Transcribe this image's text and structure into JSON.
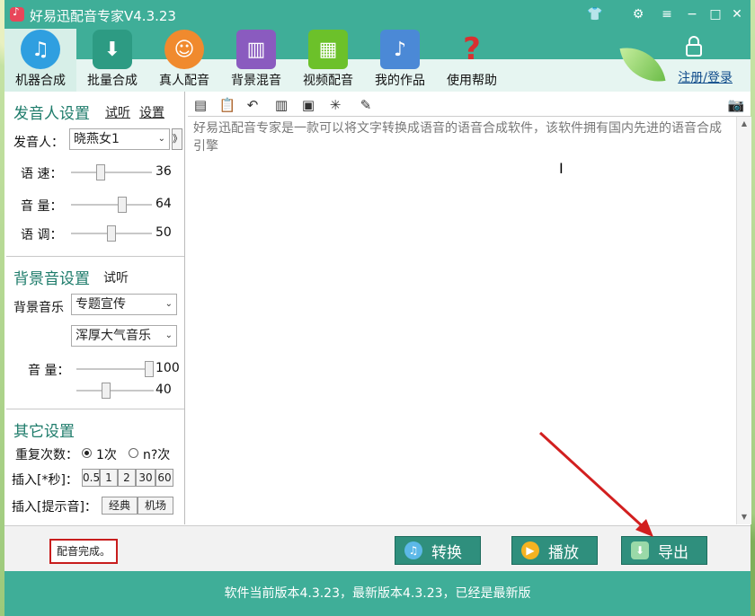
{
  "window": {
    "title": "好易迅配音专家V4.3.23"
  },
  "toolbar": {
    "tools": [
      {
        "label": "机器合成",
        "icon": "music-note-icon",
        "color": "#2f9fe0"
      },
      {
        "label": "批量合成",
        "icon": "mp3-file-icon",
        "color": "#2d9b83"
      },
      {
        "label": "真人配音",
        "icon": "person-icon",
        "color": "#f08a2e"
      },
      {
        "label": "背景混音",
        "icon": "equalizer-icon",
        "color": "#8a5bbf"
      },
      {
        "label": "视频配音",
        "icon": "film-icon",
        "color": "#6cc12a"
      },
      {
        "label": "我的作品",
        "icon": "music-folder-icon",
        "color": "#4b89d6"
      },
      {
        "label": "使用帮助",
        "icon": "question-icon",
        "color": "#d93030"
      }
    ],
    "login_label": "注册/登录"
  },
  "speaker": {
    "title": "发音人设置",
    "listen": "试听",
    "settings": "设置",
    "speaker_label": "发音人：",
    "speaker_value": "晓燕女1",
    "more": "》",
    "speed_label": "语 速：",
    "speed_value": "36",
    "volume_label": "音 量：",
    "volume_value": "64",
    "tone_label": "语 调：",
    "tone_value": "50"
  },
  "bgm": {
    "title": "背景音设置",
    "listen": "试听",
    "music_label": "背景音乐",
    "category": "专题宣传",
    "track": "浑厚大气音乐",
    "volume_label": "音 量：",
    "volume_value": "100",
    "volume2_value": "40"
  },
  "other": {
    "title": "其它设置",
    "repeat_label": "重复次数：",
    "repeat_opt1": "1次",
    "repeat_opt2": "n?次",
    "insert_label": "插入[*秒]：",
    "insert_opts": [
      "0.5",
      "1",
      "2",
      "30",
      "60"
    ],
    "insert_tone_label": "插入[提示音]：",
    "tone_opts": [
      "经典",
      "机场"
    ]
  },
  "editor": {
    "text": "好易迅配音专家是一款可以将文字转换成语音的语音合成软件，该软件拥有国内先进的语音合成引擎"
  },
  "bottom": {
    "status": "配音完成。",
    "convert": "转换",
    "play": "播放",
    "export": "导出"
  },
  "footer": {
    "version_text": "软件当前版本4.3.23，最新版本4.3.23，已经是最新版"
  }
}
